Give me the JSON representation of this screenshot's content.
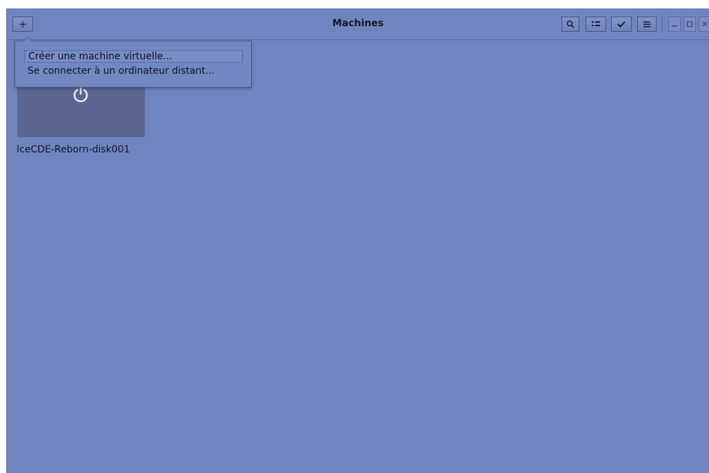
{
  "window": {
    "title": "Machines"
  },
  "toolbar": {
    "add_label": "+",
    "add_icon": "plus-icon",
    "search_icon": "search-icon",
    "view_icon": "view-mode-icon",
    "select_icon": "checkmark-icon",
    "menu_icon": "hamburger-menu-icon"
  },
  "window_controls": {
    "minimize_icon": "minimize-icon",
    "maximize_icon": "maximize-icon",
    "close_icon": "close-icon"
  },
  "popover": {
    "items": [
      {
        "label": "Créer une machine virtuelle..."
      },
      {
        "label": "Se connecter à un ordinateur distant..."
      }
    ]
  },
  "machines": [
    {
      "name": "IceCDE-Reborn-disk001",
      "state_icon": "power-icon"
    }
  ],
  "colors": {
    "background": "#7085bf",
    "thumbnail": "#5a6690"
  }
}
